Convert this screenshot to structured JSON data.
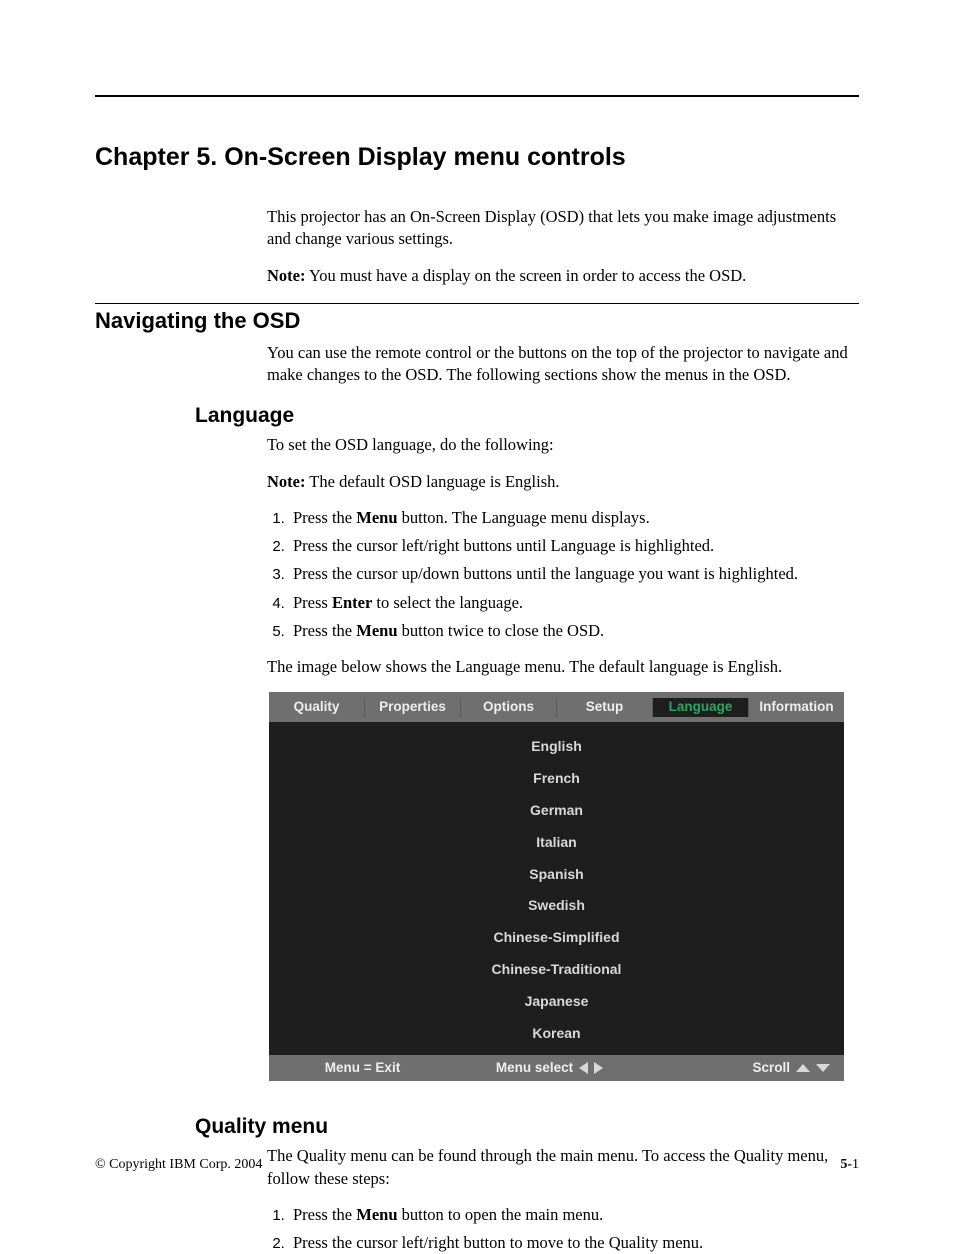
{
  "chapter_title": "Chapter 5. On-Screen Display menu controls",
  "intro_para": "This projector has an On-Screen Display (OSD) that lets you make image adjustments and change various settings.",
  "intro_note_label": "Note:",
  "intro_note_text": " You must have a display on the screen in order to access the OSD.",
  "nav": {
    "heading": "Navigating the OSD",
    "para": "You can use the remote control or the buttons on the top of the projector to navigate and make changes to the OSD. The following sections show the menus in the OSD."
  },
  "language": {
    "heading": "Language",
    "intro": "To set the OSD language, do the following:",
    "note_label": "Note:",
    "note_text": " The default OSD language is English.",
    "steps": {
      "s1_a": "Press the ",
      "s1_b": "Menu",
      "s1_c": " button. The Language menu displays.",
      "s2": "Press the cursor left/right buttons until Language is highlighted.",
      "s3": "Press the cursor up/down buttons until the language you want is highlighted.",
      "s4_a": "Press ",
      "s4_b": "Enter",
      "s4_c": " to select the language.",
      "s5_a": "Press the ",
      "s5_b": "Menu",
      "s5_c": " button twice to close the OSD."
    },
    "caption": "The image below shows the Language menu. The default language is English."
  },
  "osd": {
    "tabs": [
      "Quality",
      "Properties",
      "Options",
      "Setup",
      "Language",
      "Information"
    ],
    "active_tab_index": 4,
    "items": [
      "English",
      "French",
      "German",
      "Italian",
      "Spanish",
      "Swedish",
      "Chinese-Simplified",
      "Chinese-Traditional",
      "Japanese",
      "Korean"
    ],
    "footer": {
      "exit": "Menu = Exit",
      "select": "Menu select",
      "scroll": "Scroll"
    }
  },
  "quality": {
    "heading": "Quality menu",
    "intro": "The Quality menu can be found through the main menu. To access the Quality menu, follow these steps:",
    "steps": {
      "s1_a": "Press the ",
      "s1_b": "Menu",
      "s1_c": " button to open the main menu.",
      "s2": "Press the cursor left/right button to move to the Quality menu."
    }
  },
  "footer": {
    "copyright": "© Copyright IBM Corp. 2004",
    "page_prefix": "5-",
    "page_num": "1"
  }
}
